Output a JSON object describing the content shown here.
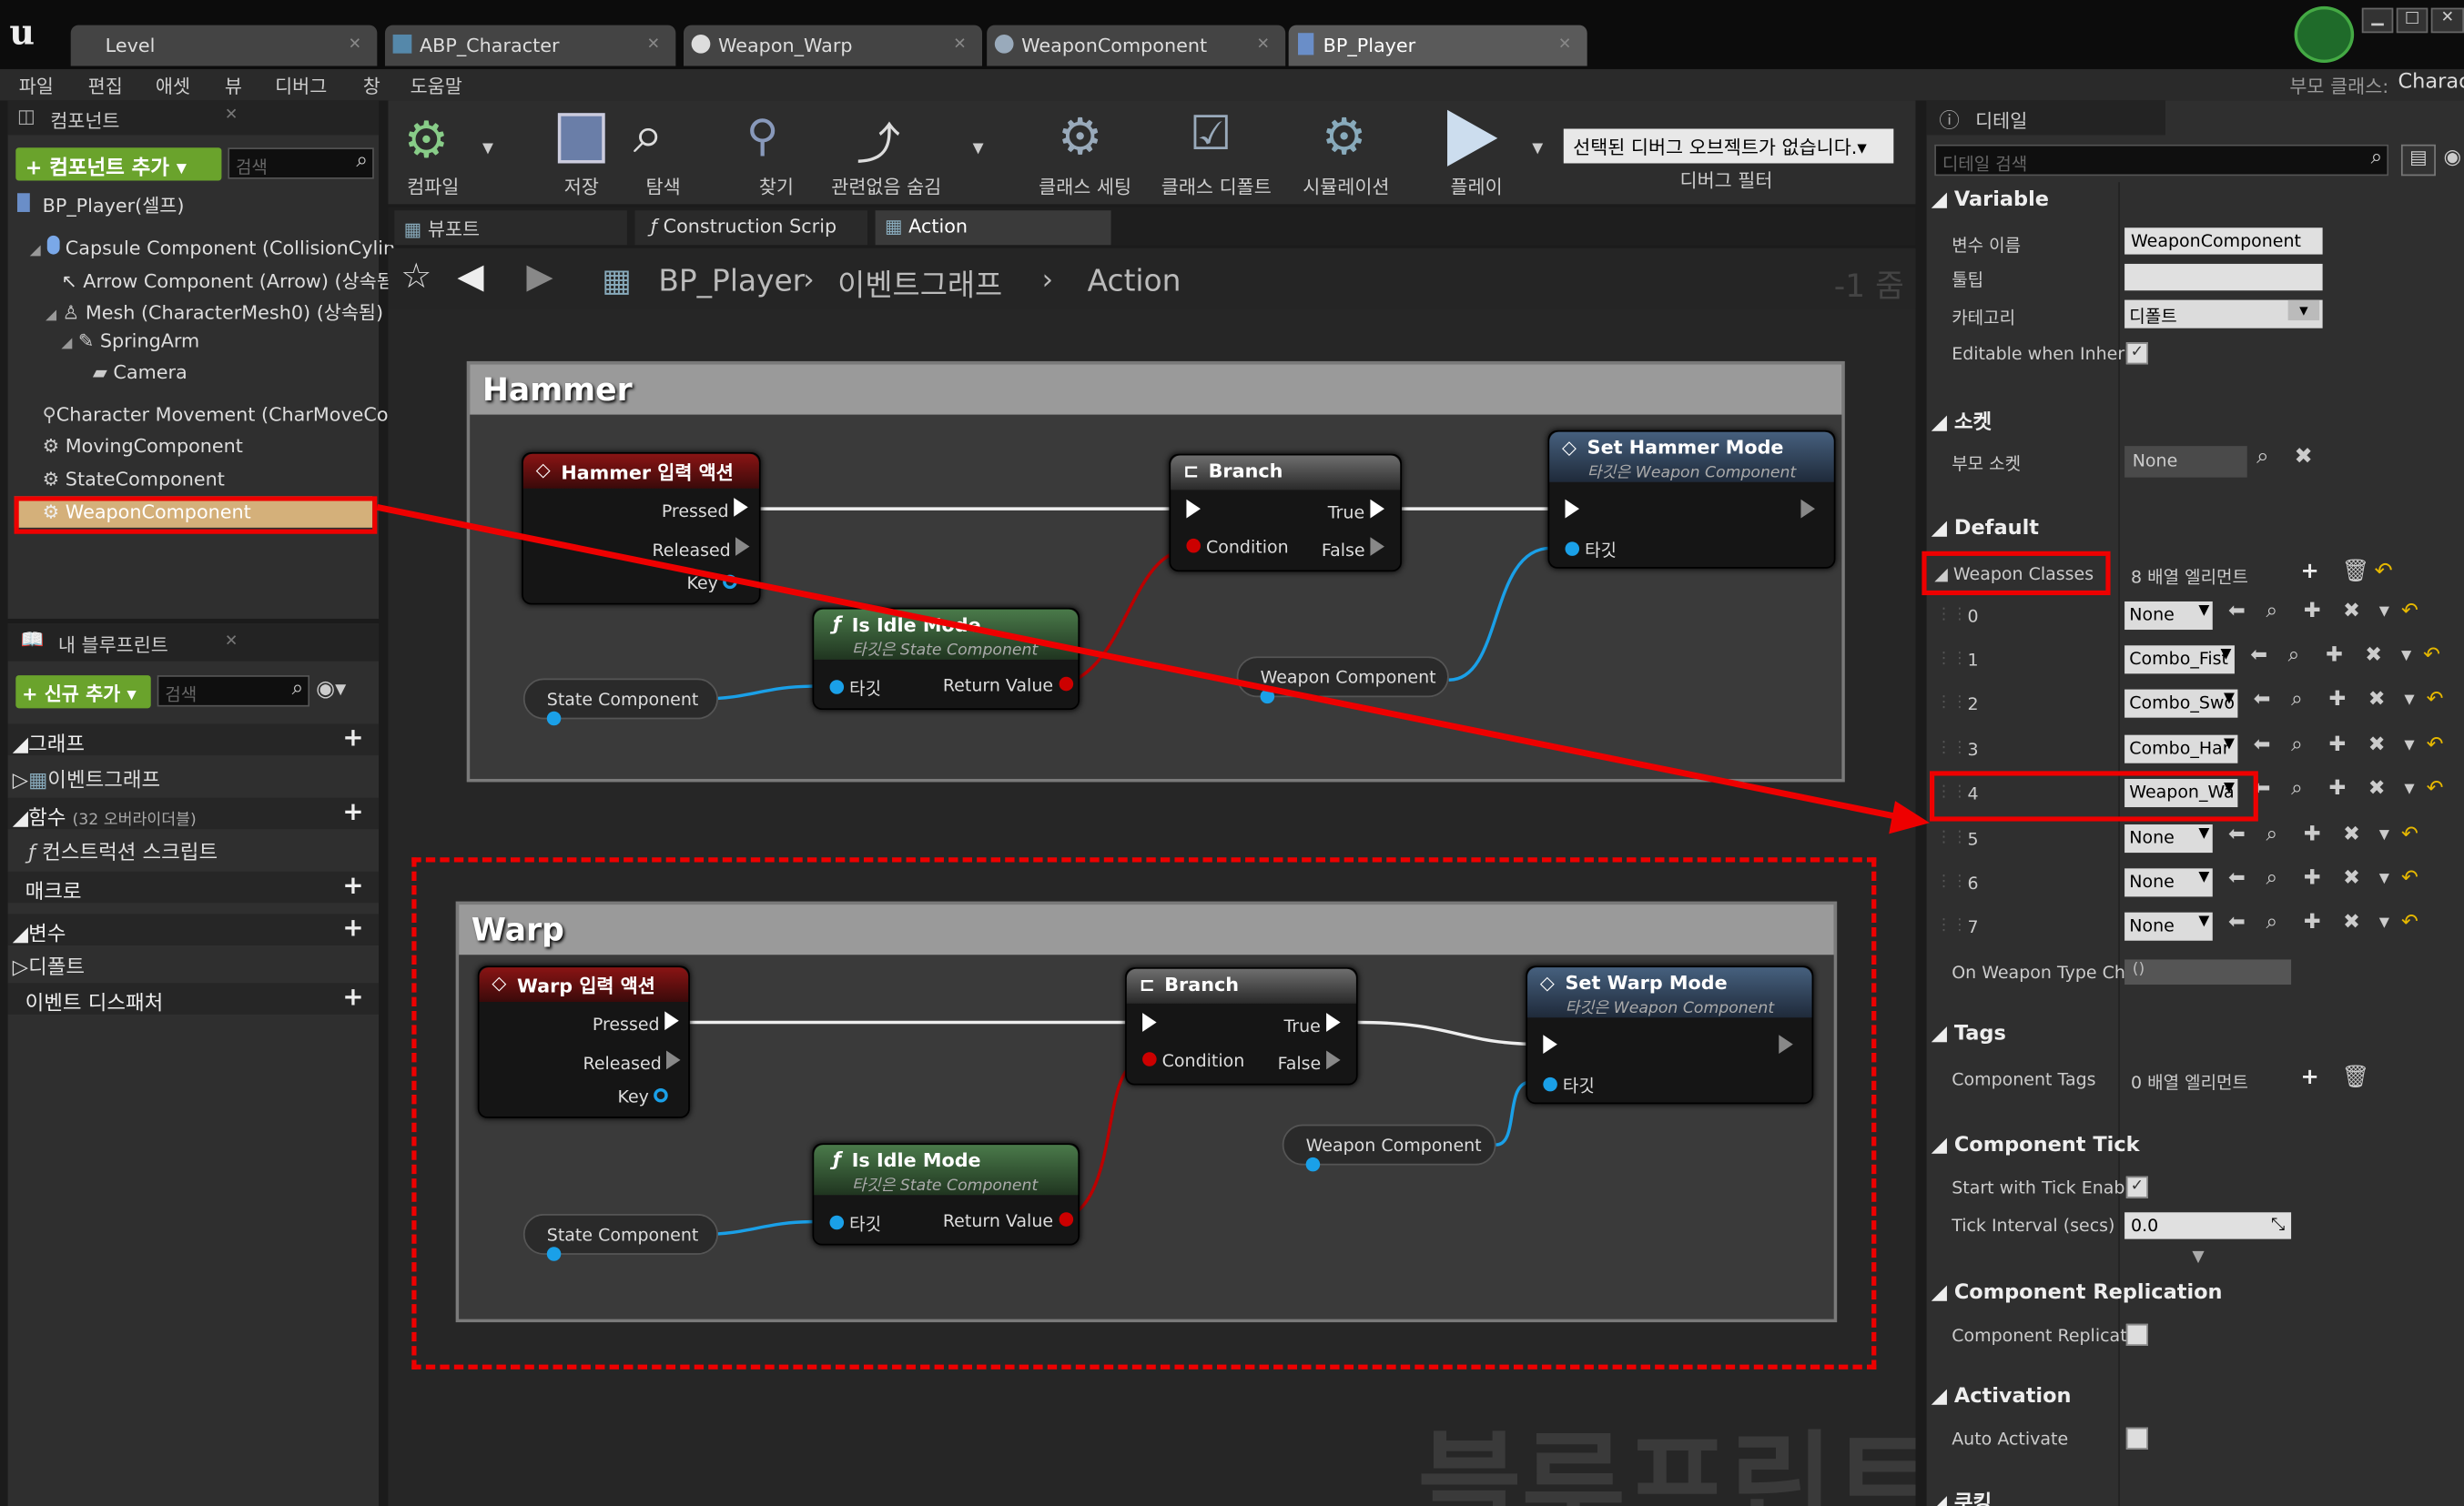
{
  "tabs": [
    {
      "label": "Level"
    },
    {
      "label": "ABP_Character"
    },
    {
      "label": "Weapon_Warp"
    },
    {
      "label": "WeaponComponent"
    },
    {
      "label": "BP_Player"
    }
  ],
  "menu": [
    "파일",
    "편집",
    "애셋",
    "뷰",
    "디버그",
    "창",
    "도움말"
  ],
  "parent_class_label": "부모 클래스:",
  "parent_class_value": "Charac",
  "components_panel": {
    "title": "컴포넌트",
    "add_button": "+ 컴포넌트 추가 ▾",
    "search_placeholder": "검색",
    "root": "BP_Player(셀프)",
    "items": [
      "Capsule Component (CollisionCylin",
      "Arrow Component (Arrow) (상속됨",
      "Mesh (CharacterMesh0) (상속됨)",
      "SpringArm",
      "Camera",
      "Character Movement (CharMoveCo",
      "MovingComponent",
      "StateComponent",
      "WeaponComponent"
    ]
  },
  "mybp_panel": {
    "title": "내 블루프린트",
    "add_button": "+ 신규 추가 ▾",
    "search_placeholder": "검색",
    "sections": {
      "graph": "그래프",
      "event_graph": "이벤트그래프",
      "functions": "함수",
      "functions_count": "(32 오버라이더블)",
      "construction": "컨스트럭션 스크립트",
      "macros": "매크로",
      "variables": "변수",
      "default": "디폴트",
      "dispatchers": "이벤트 디스패처"
    }
  },
  "toolbar": {
    "compile": "컴파일",
    "save": "저장",
    "browse": "탐색",
    "find": "찾기",
    "hide_unrelated": "관련없음 숨김",
    "class_settings": "클래스 세팅",
    "class_defaults": "클래스 디폴트",
    "simulation": "시뮬레이션",
    "play": "플레이",
    "debug_select": "선택된 디버그 오브젝트가 없습니다.▾",
    "debug_filter": "디버그 필터"
  },
  "graph_tabs": [
    "뷰포트",
    "Construction Scrip",
    "Action"
  ],
  "breadcrumb": {
    "root": "BP_Player",
    "event_graph": "이벤트그래프",
    "current": "Action",
    "zoom": "-1 줌"
  },
  "watermark": "블루프린트",
  "hammer": {
    "comment": "Hammer",
    "input_title": "Hammer 입력 액션",
    "pressed": "Pressed",
    "released": "Released",
    "key": "Key",
    "branch": "Branch",
    "true": "True",
    "condition": "Condition",
    "false": "False",
    "set_mode": "Set Hammer Mode",
    "set_target_sub": "타깃은 Weapon Component",
    "target": "타깃",
    "idle_title": "Is Idle Mode",
    "idle_sub": "타깃은 State Component",
    "return_value": "Return Value",
    "state_component": "State Component",
    "weapon_component": "Weapon Component"
  },
  "warp": {
    "comment": "Warp",
    "input_title": "Warp 입력 액션",
    "pressed": "Pressed",
    "released": "Released",
    "key": "Key",
    "branch": "Branch",
    "true": "True",
    "condition": "Condition",
    "false": "False",
    "set_mode": "Set Warp Mode",
    "set_target_sub": "타깃은 Weapon Component",
    "target": "타깃",
    "idle_title": "Is Idle Mode",
    "idle_sub": "타깃은 State Component",
    "return_value": "Return Value",
    "state_component": "State Component",
    "weapon_component": "Weapon Component"
  },
  "details": {
    "title": "디테일",
    "search_placeholder": "디테일 검색",
    "variable_section": "Variable",
    "var_name_label": "변수 이름",
    "var_name_value": "WeaponComponent",
    "tooltip_label": "툴팁",
    "category_label": "카테고리",
    "category_value": "디폴트",
    "editable_label": "Editable when Inherit",
    "socket_section": "소켓",
    "parent_socket_label": "부모 소켓",
    "parent_socket_value": "None",
    "default_section": "Default",
    "weapon_classes_label": "Weapon Classes",
    "weapon_classes_value": "8 배열 엘리먼트",
    "array": [
      {
        "index": "0",
        "value": "None"
      },
      {
        "index": "1",
        "value": "Combo_Fist"
      },
      {
        "index": "2",
        "value": "Combo_Swo"
      },
      {
        "index": "3",
        "value": "Combo_Har"
      },
      {
        "index": "4",
        "value": "Weapon_Wa"
      },
      {
        "index": "5",
        "value": "None"
      },
      {
        "index": "6",
        "value": "None"
      },
      {
        "index": "7",
        "value": "None"
      }
    ],
    "on_weapon_type_label": "On Weapon Type Cha",
    "on_weapon_type_value": "()",
    "tags_section": "Tags",
    "component_tags_label": "Component Tags",
    "component_tags_value": "0 배열 엘리먼트",
    "tick_section": "Component Tick",
    "start_tick_label": "Start with Tick Enable",
    "tick_interval_label": "Tick Interval (secs)",
    "tick_interval_value": "0.0",
    "replication_section": "Component Replication",
    "replicates_label": "Component Replicate",
    "activation_section": "Activation",
    "auto_activate_label": "Auto Activate",
    "cooking_section": "쿠킹"
  },
  "colors": {
    "accent_green": "#6aa32c",
    "highlight_red": "#e00000",
    "selected_row": "#d4b07a"
  }
}
